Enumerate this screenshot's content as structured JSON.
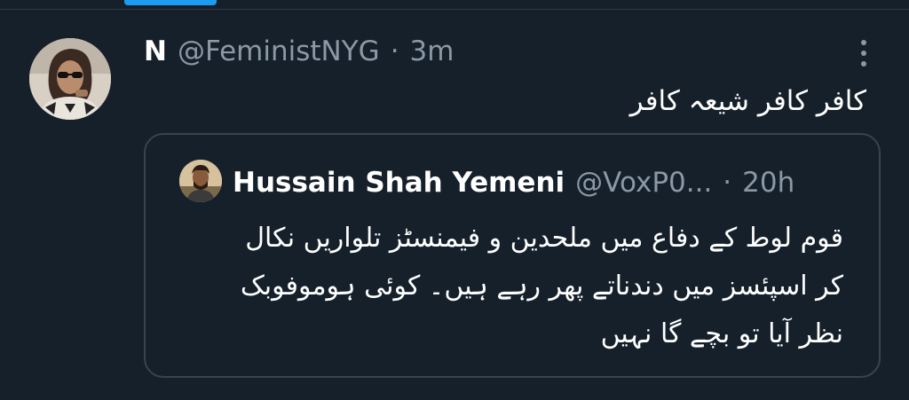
{
  "tweet": {
    "display_name": "N",
    "handle": "@FeministNYG",
    "separator": "·",
    "time": "3m",
    "text": "کافر کافر شیعہ کافر"
  },
  "quoted_tweet": {
    "display_name": "Hussain Shah Yemeni",
    "handle": "@VoxP0...",
    "separator": "·",
    "time": "20h",
    "text_lines": [
      "قوم لوط کے دفاع میں ملحدین و فیمنسٹز تلواریں نکال",
      "کر اسپئسز میں دندناتے پھر رہے ہیں۔ کوئی ہوموفوبک",
      "نظر آیا تو بچے گا نہیں"
    ]
  },
  "icons": {
    "more": "more-vertical-icon",
    "avatar": "user-avatar",
    "quoted_avatar": "quoted-user-avatar"
  },
  "colors": {
    "background": "#15202b",
    "accent": "#1d9bf0",
    "secondary_text": "#8b98a5",
    "border": "#38444d"
  }
}
